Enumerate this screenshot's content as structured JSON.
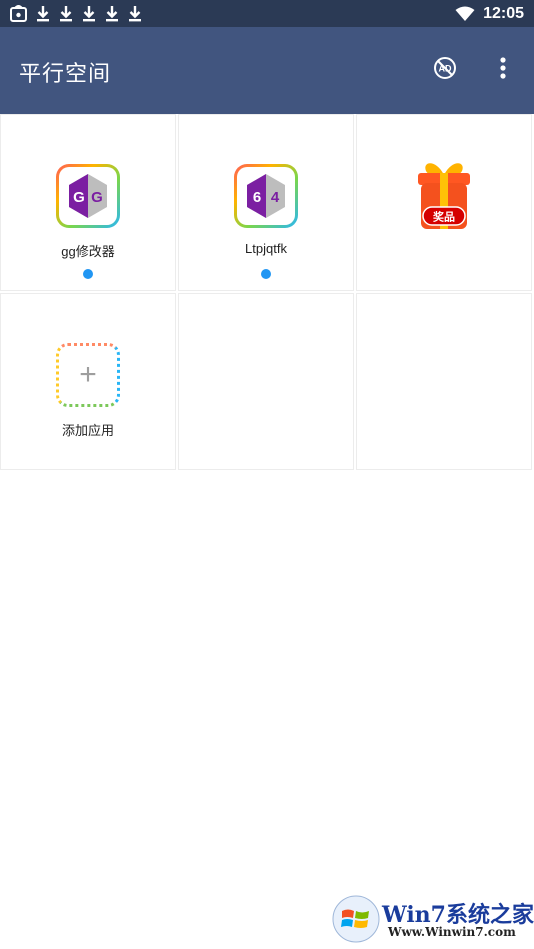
{
  "status_bar": {
    "time": "12:05",
    "icons": [
      "notification-app-icon",
      "download-icon",
      "download-icon",
      "download-icon",
      "download-icon",
      "download-icon",
      "wifi-icon"
    ]
  },
  "app_bar": {
    "title": "平行空间",
    "ad_icon": "ad-free-icon",
    "menu_icon": "more-vert-icon",
    "background": "#41557f"
  },
  "apps": [
    {
      "label": "gg修改器",
      "icon": "gg-icon",
      "glyph": "GG",
      "has_dot": true
    },
    {
      "label": "Ltpjqtfk",
      "icon": "gg64-icon",
      "glyph": "64",
      "has_dot": true
    },
    {
      "label": "",
      "icon": "gift-icon",
      "badge": "奖品",
      "has_dot": false
    },
    {
      "label": "添加应用",
      "icon": "add-app-icon",
      "has_dot": false
    }
  ],
  "colors": {
    "status_bar": "#2b3a55",
    "dot": "#2196f3",
    "gg_purple": "#7b1fa2"
  },
  "watermark": {
    "text": "Win7系统之家",
    "url": "Www.Winwin7.com"
  }
}
